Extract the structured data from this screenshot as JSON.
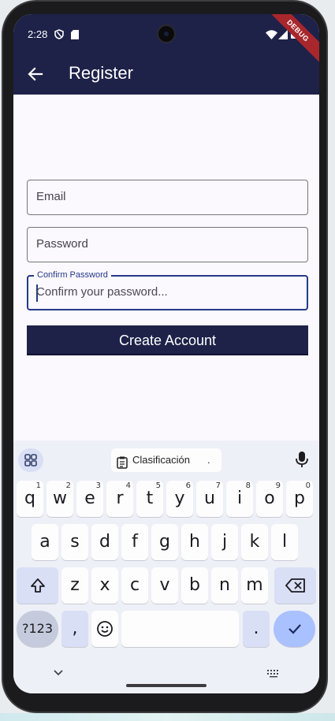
{
  "status_bar": {
    "time": "2:28",
    "debug_banner": "DEBUG"
  },
  "app_bar": {
    "title": "Register"
  },
  "form": {
    "email": {
      "placeholder": "Email"
    },
    "password": {
      "placeholder": "Password"
    },
    "confirm_password": {
      "label": "Confirm Password",
      "placeholder": "Confirm your password..."
    },
    "submit_label": "Create Account"
  },
  "keyboard": {
    "suggestion": "Clasificación",
    "suggestion_extra": ".",
    "row1": [
      {
        "k": "q",
        "h": "1"
      },
      {
        "k": "w",
        "h": "2"
      },
      {
        "k": "e",
        "h": "3"
      },
      {
        "k": "r",
        "h": "4"
      },
      {
        "k": "t",
        "h": "5"
      },
      {
        "k": "y",
        "h": "6"
      },
      {
        "k": "u",
        "h": "7"
      },
      {
        "k": "i",
        "h": "8"
      },
      {
        "k": "o",
        "h": "9"
      },
      {
        "k": "p",
        "h": "0"
      }
    ],
    "row2": [
      "a",
      "s",
      "d",
      "f",
      "g",
      "h",
      "j",
      "k",
      "l"
    ],
    "row3": [
      "z",
      "x",
      "c",
      "v",
      "b",
      "n",
      "m"
    ],
    "symbols_label": "?123",
    "comma": ",",
    "period": "."
  },
  "colors": {
    "primary": "#1e2249",
    "focus": "#253a86",
    "background": "#fbf8fe",
    "debug": "#a8272d"
  }
}
